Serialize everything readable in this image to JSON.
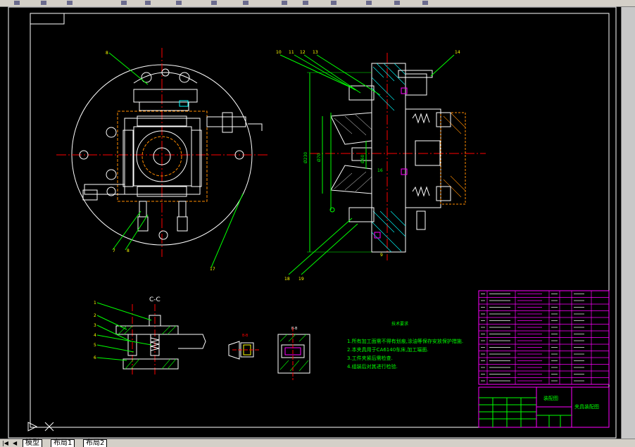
{
  "tabs": {
    "model": "模型",
    "layout1": "布局1",
    "layout2": "布局2"
  },
  "drawing": {
    "section_cc": "C-C",
    "section_bb": "B-B",
    "section_bb2": "B-B",
    "tech_title": "技术要求",
    "tech_lines": [
      "1.所有加工面需不得有划痕,涂油等保存安放保护措施.",
      "2.本夹具用于CA6140车床,加工端面.",
      "3.工件夹紧后需检查.",
      "4.组装后对其进行检验."
    ],
    "dim_a": "Ø230",
    "dim_b": "Ø70",
    "dim_c": "Ø60",
    "dim_d": "16",
    "title_block": {
      "drawing_name": "装配图",
      "part_name": "夹具装配图"
    },
    "balloons_left": [
      "1",
      "2",
      "3",
      "4",
      "5",
      "6"
    ],
    "balloons_top": [
      "8",
      "10",
      "11",
      "12",
      "13",
      "14"
    ],
    "balloons_bottom": [
      "7",
      "8",
      "17",
      "18",
      "19",
      "9"
    ]
  },
  "colors": {
    "background": "#000000",
    "border": "#ffffff",
    "centerline": "#ff0000",
    "outline": "#ffffff",
    "dimension": "#00ff00",
    "hidden": "#ff8c00",
    "section": "#00ffff",
    "text_green": "#00ff00",
    "title_border": "#ff00ff"
  }
}
